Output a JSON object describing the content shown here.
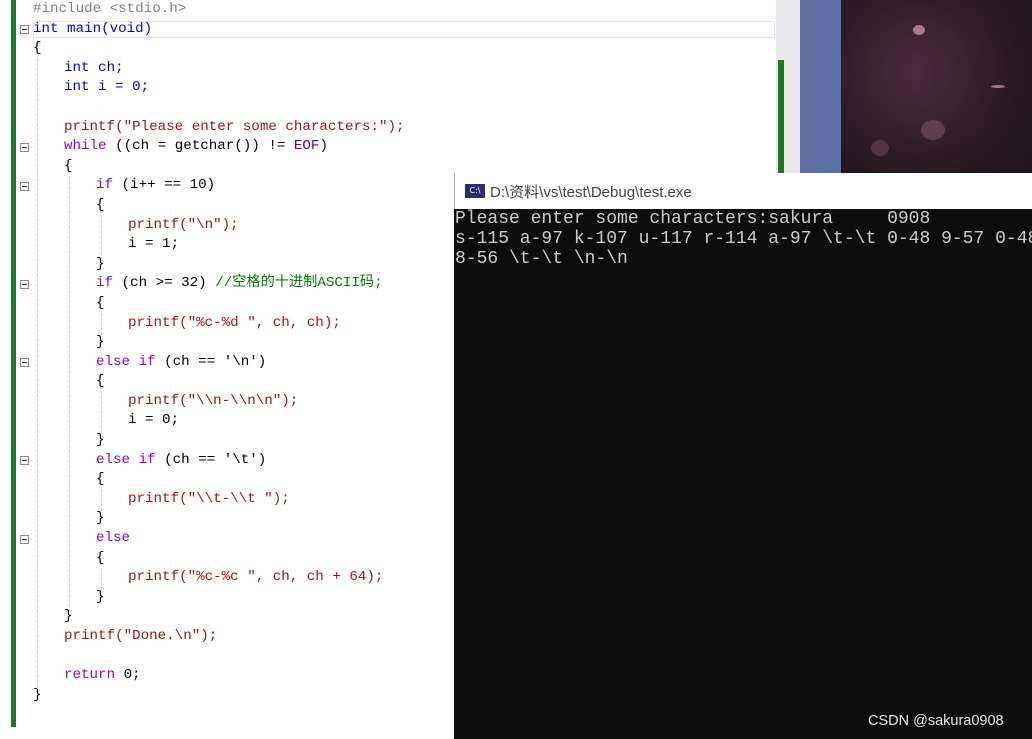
{
  "editor": {
    "lines": {
      "l1": "#include <stdio.h>",
      "l2": "int main(void)",
      "l3": "{",
      "l4": "int ch;",
      "l5": "int i = 0;",
      "l6": "printf(\"Please enter some characters:\");",
      "l7a": "while",
      "l7b": " ((ch = getchar()) != ",
      "l7c": "EOF",
      "l7d": ")",
      "l8": "{",
      "l9a": "if",
      "l9b": " (i++ == 10)",
      "l10": "{",
      "l11": "printf(\"\\n\");",
      "l12": "i = 1;",
      "l13": "}",
      "l14a": "if",
      "l14b": " (ch >= 32) ",
      "l14c": "//空格的十进制ASCII码;",
      "l15": "{",
      "l16": "printf(\"%c-%d \", ch, ch);",
      "l17": "}",
      "l18a": "else",
      "l18b": " ",
      "l18c": "if",
      "l18d": " (ch == '\\n')",
      "l19": "{",
      "l20": "printf(\"\\\\n-\\\\n\\n\");",
      "l21": "i = 0;",
      "l22": "}",
      "l23a": "else",
      "l23b": " ",
      "l23c": "if",
      "l23d": " (ch == '\\t')",
      "l24": "{",
      "l25": "printf(\"\\\\t-\\\\t \");",
      "l26": "}",
      "l27": "else",
      "l28": "{",
      "l29": "printf(\"%c-%c \", ch, ch + 64);",
      "l30": "}",
      "l31": "}",
      "l32": "printf(\"Done.\\n\");",
      "l33a": "return",
      "l33b": " 0;",
      "l34": "}"
    }
  },
  "console": {
    "title": "D:\\资料\\vs\\test\\Debug\\test.exe",
    "icon_label": "C:\\",
    "output": "Please enter some characters:sakura     0908\ns-115 a-97 k-107 u-117 r-114 a-97 \\t-\\t 0-48 9-57 0-48\n8-56 \\t-\\t \\n-\\n"
  },
  "watermark": "CSDN @sakura0908",
  "colors": {
    "keyword": "#0000ff",
    "control": "#8f08c4",
    "string": "#a31515",
    "comment": "#008000",
    "console_bg": "#0c0c0c",
    "gutter_green": "#1f7a1f"
  }
}
